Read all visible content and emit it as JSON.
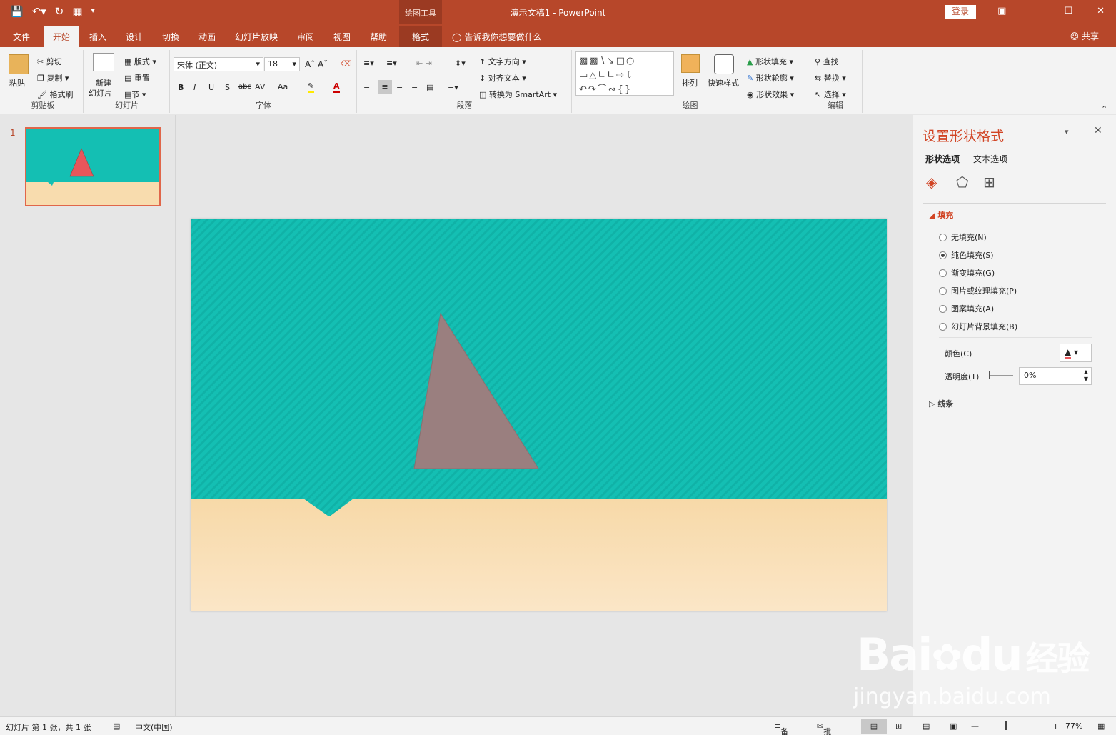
{
  "window": {
    "title": "演示文稿1  -  PowerPoint",
    "login_label": "登录",
    "context_group_label": "绘图工具",
    "controls": [
      "restore-icon",
      "minimize-icon",
      "maximize-icon",
      "close-icon"
    ]
  },
  "qat": {
    "icons": [
      "save-icon",
      "undo-icon",
      "redo-icon",
      "present-icon",
      "customize-icon"
    ]
  },
  "tabs": [
    "文件",
    "开始",
    "插入",
    "设计",
    "切换",
    "动画",
    "幻灯片放映",
    "审阅",
    "视图",
    "帮助"
  ],
  "active_tab": "开始",
  "context_tab": "格式",
  "tell_me": "告诉我你想要做什么",
  "share": "共享",
  "ribbon": {
    "clipboard": {
      "label": "剪贴板",
      "paste": "粘贴",
      "cut": "剪切",
      "copy": "复制",
      "format_painter": "格式刷"
    },
    "slides": {
      "label": "幻灯片",
      "new_slide_1": "新建",
      "new_slide_2": "幻灯片",
      "layout": "版式",
      "reset": "重置",
      "section": "节"
    },
    "font": {
      "label": "字体",
      "font_name": "宋体 (正文)",
      "font_size": "18",
      "buttons": [
        "B",
        "I",
        "U",
        "S",
        "abc",
        "AV",
        "Aa"
      ]
    },
    "paragraph": {
      "label": "段落",
      "text_direction": "文字方向",
      "align_text": "对齐文本",
      "smartart": "转换为 SmartArt"
    },
    "drawing": {
      "label": "绘图",
      "arrange": "排列",
      "quick_styles": "快速样式",
      "shape_fill": "形状填充",
      "shape_outline": "形状轮廓",
      "shape_effects": "形状效果"
    },
    "editing": {
      "label": "编辑",
      "find": "查找",
      "replace": "替换",
      "select": "选择"
    }
  },
  "thumbnail": {
    "number": "1"
  },
  "slide": {
    "colors": {
      "sea": "#14bfb3",
      "sand": "#f7d9a8",
      "triangle": "#9a7f7f",
      "thumb_triangle": "#e8565b"
    }
  },
  "format_pane": {
    "title": "设置形状格式",
    "tabs": [
      "形状选项",
      "文本选项"
    ],
    "fill_section": "填充",
    "fill_options": [
      {
        "label": "无填充(N)",
        "selected": false
      },
      {
        "label": "纯色填充(S)",
        "selected": true
      },
      {
        "label": "渐变填充(G)",
        "selected": false
      },
      {
        "label": "图片或纹理填充(P)",
        "selected": false
      },
      {
        "label": "图案填充(A)",
        "selected": false
      },
      {
        "label": "幻灯片背景填充(B)",
        "selected": false
      }
    ],
    "color_label": "颜色(C)",
    "transparency_label": "透明度(T)",
    "transparency_value": "0%",
    "line_section": "线条"
  },
  "status": {
    "slide_info": "幻灯片 第 1 张，共 1 张",
    "language": "中文(中国)",
    "notes": "备注",
    "comments": "批注",
    "zoom": "77%"
  },
  "watermark": {
    "brand": "Bai",
    "brand2": "du",
    "cn": "经验",
    "url": "jingyan.baidu.com"
  }
}
